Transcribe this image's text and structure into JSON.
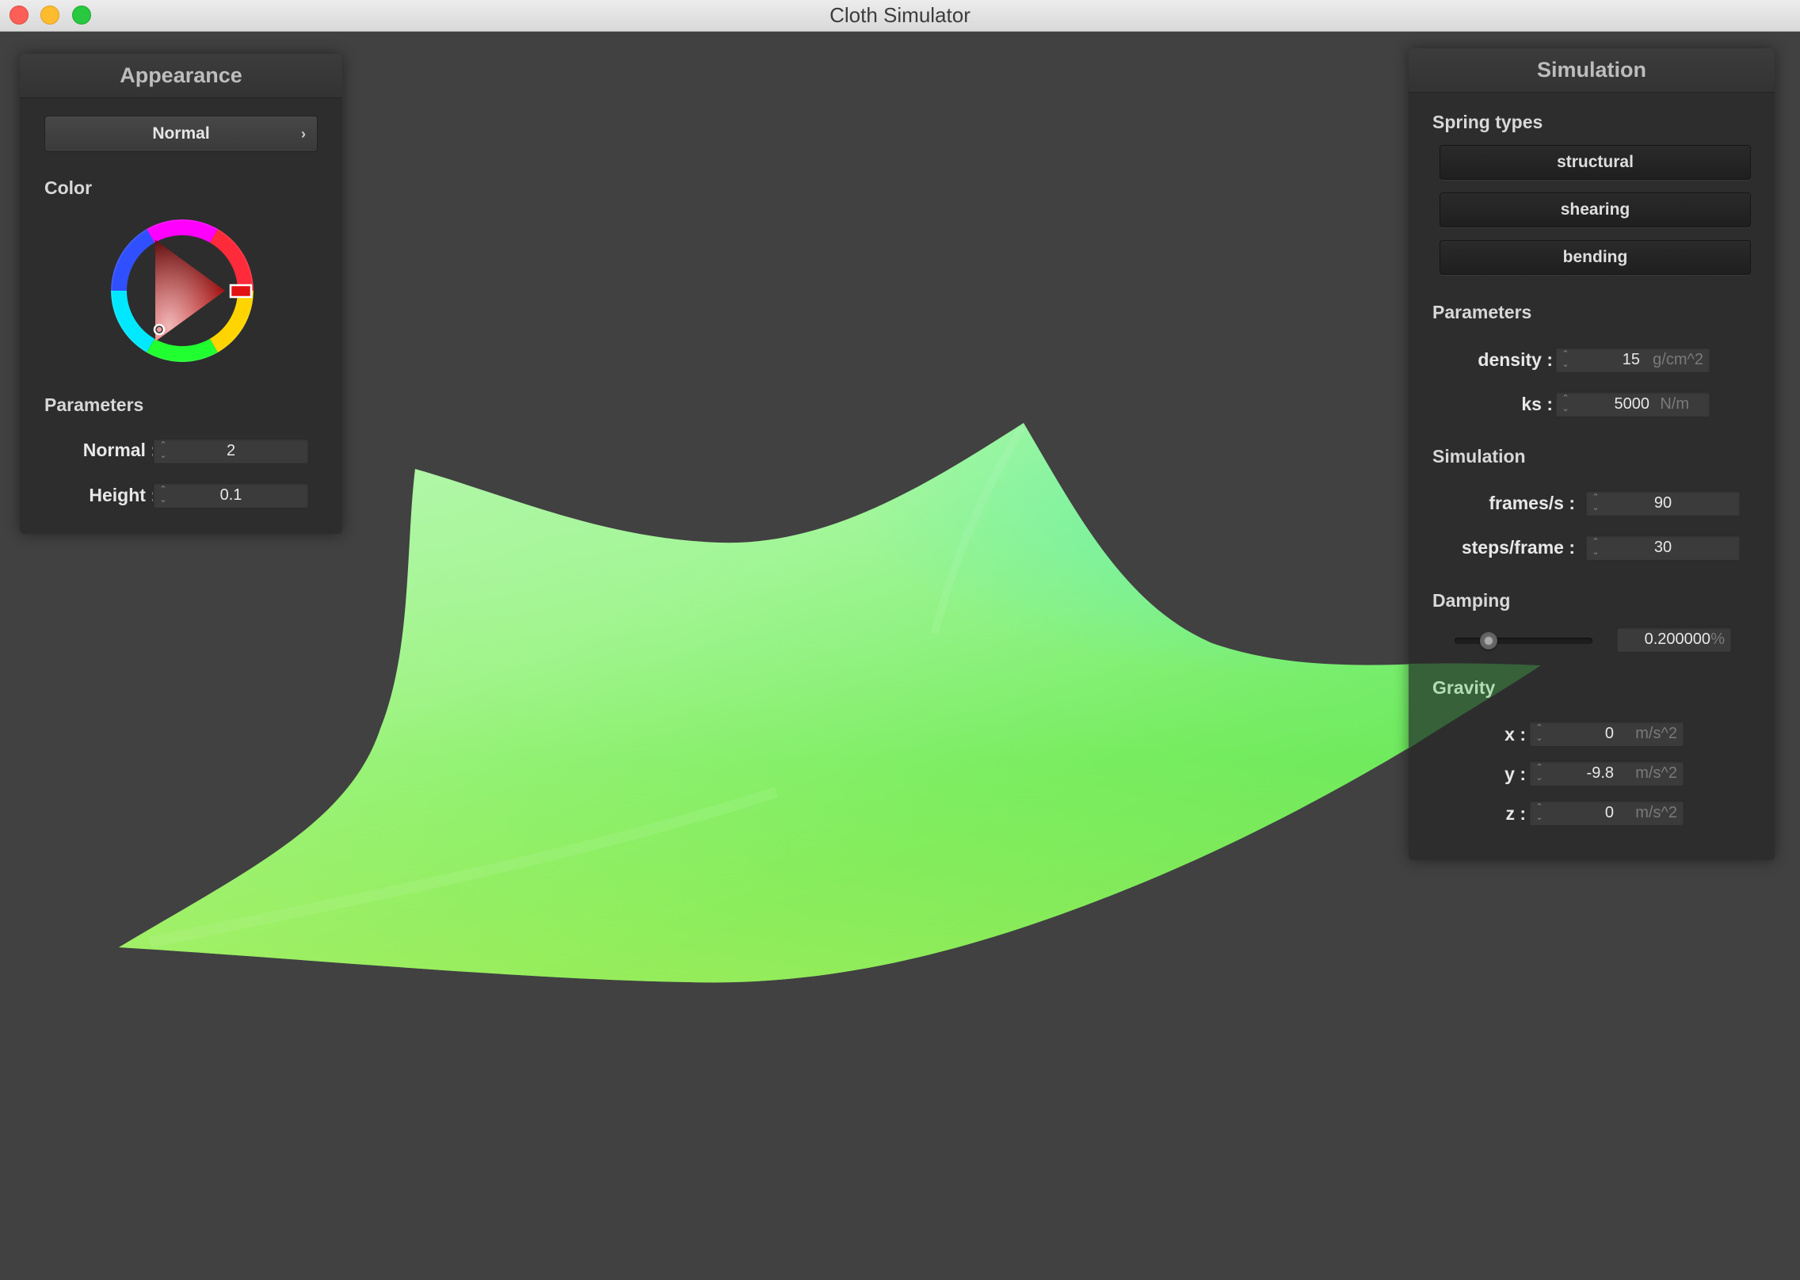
{
  "window": {
    "title": "Cloth Simulator"
  },
  "appearance": {
    "title": "Appearance",
    "shader_dropdown": {
      "value": "Normal",
      "chevron": "›"
    },
    "color_label": "Color",
    "color_wheel": {
      "selected_hue": "#ff0000"
    },
    "parameters_label": "Parameters",
    "normal": {
      "label": "Normal :",
      "value": "2"
    },
    "height": {
      "label": "Height :",
      "value": "0.1"
    }
  },
  "simulation": {
    "title": "Simulation",
    "spring_types_label": "Spring types",
    "spring_buttons": [
      "structural",
      "shearing",
      "bending"
    ],
    "parameters_label": "Parameters",
    "density": {
      "label": "density :",
      "value": "15",
      "unit": "g/cm^2"
    },
    "ks": {
      "label": "ks :",
      "value": "5000",
      "unit": "N/m"
    },
    "simulation_label": "Simulation",
    "frames_per_s": {
      "label": "frames/s :",
      "value": "90"
    },
    "steps_per_frame": {
      "label": "steps/frame :",
      "value": "30"
    },
    "damping_label": "Damping",
    "damping": {
      "value": "0.200000",
      "unit": "%",
      "slider_fraction": 0.2
    },
    "gravity_label": "Gravity",
    "gravity": {
      "x": {
        "label": "x :",
        "value": "0",
        "unit": "m/s^2"
      },
      "y": {
        "label": "y :",
        "value": "-9.8",
        "unit": "m/s^2"
      },
      "z": {
        "label": "z :",
        "value": "0",
        "unit": "m/s^2"
      }
    }
  },
  "colors": {
    "background": "#414141",
    "panel": "#2d2d2d",
    "cloth_light": "#a8f39a",
    "cloth_mid": "#6ef07a",
    "cloth_dark": "#9be84a"
  }
}
